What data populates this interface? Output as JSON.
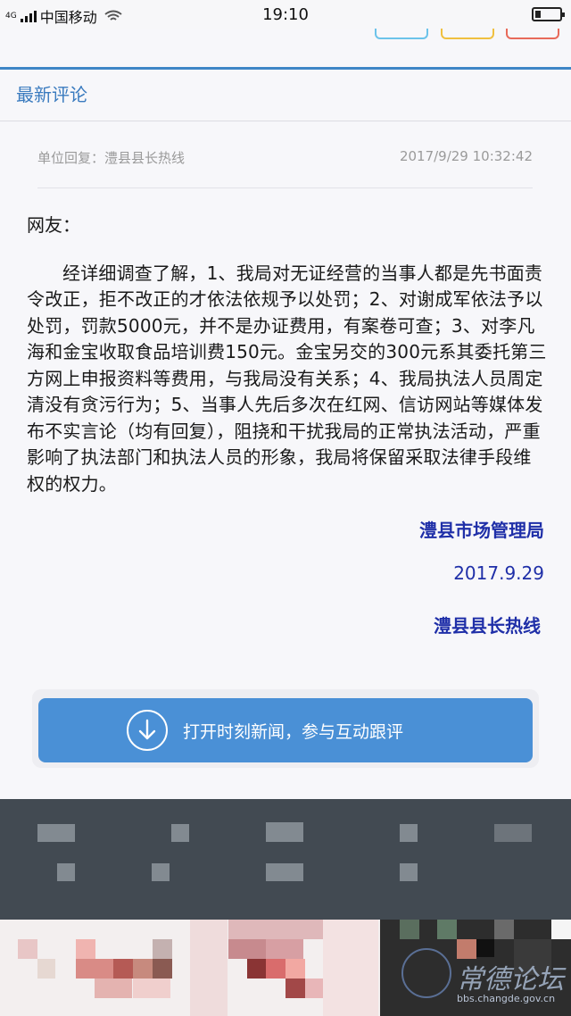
{
  "status_bar": {
    "network": "4G",
    "carrier": "中国移动",
    "time": "19:10"
  },
  "section": {
    "title": "最新评论"
  },
  "reply": {
    "meta": "单位回复：澧县县长热线",
    "timestamp": "2017/9/29 10:32:42",
    "greeting": "网友：",
    "body": "经详细调查了解，1、我局对无证经营的当事人都是先书面责令改正，拒不改正的才依法依规予以处罚；2、对谢成军依法予以处罚，罚款5000元，并不是办证费用，有案卷可查；3、对李凡海和金宝收取食品培训费150元。金宝另交的300元系其委托第三方网上申报资料等费用，与我局没有关系；4、我局执法人员周定清没有贪污行为；5、当事人先后多次在红网、信访网站等媒体发布不实言论（均有回复），阻挠和干扰我局的正常执法活动，严重影响了执法部门和执法人员的形象，我局将保留采取法律手段维权的权力。",
    "signature": "澧县市场管理局",
    "date": "2017.9.29",
    "source": "澧县县长热线"
  },
  "open_button": {
    "label": "打开时刻新闻，参与互动跟评",
    "icon": "download-arrow-icon"
  },
  "watermark": {
    "text": "常德论坛",
    "url": "bbs.changde.gov.cn"
  },
  "colors": {
    "accent": "#3a7bbf",
    "signature": "#1f2fa8",
    "button": "#4a90d6"
  }
}
